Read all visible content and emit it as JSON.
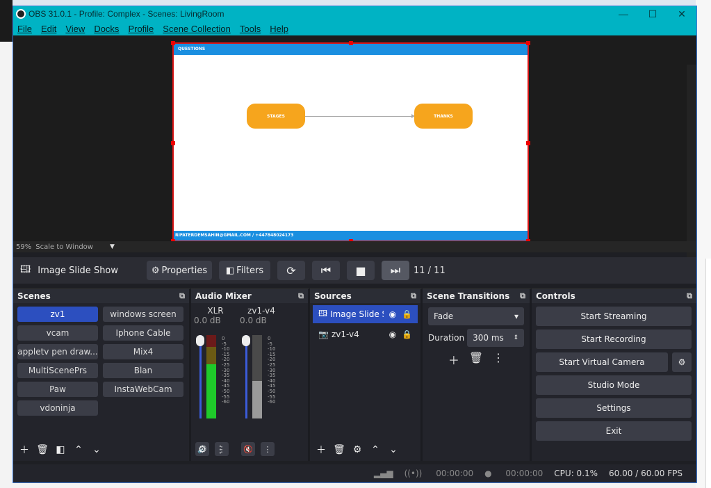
{
  "window": {
    "title": "OBS 31.0.1 - Profile: Complex - Scenes: LivingRoom"
  },
  "menu": [
    "File",
    "Edit",
    "View",
    "Docks",
    "Profile",
    "Scene Collection",
    "Tools",
    "Help"
  ],
  "preview": {
    "slide_header": "QUESTIONS",
    "slide_footer": "RIFATERDEMSAHIN@GMAIL.COM / +447848024173",
    "box_left": "STAGES",
    "box_right": "THANKS",
    "zoom": "59%",
    "scale_mode": "Scale to Window"
  },
  "toolbar": {
    "source_name": "Image Slide Show",
    "properties": "Properties",
    "filters": "Filters",
    "counter": "11 / 11"
  },
  "scenes": {
    "title": "Scenes",
    "items": [
      "zv1",
      "windows screen",
      "vcam",
      "Iphone Cable",
      "appletv pen draw...",
      "Mix4",
      "MultiScenePrs",
      "Blan",
      "Paw",
      "InstaWebCam",
      "vdoninja"
    ]
  },
  "mixer": {
    "title": "Audio Mixer",
    "channels": [
      {
        "name": "XLR",
        "db": "0.0 dB"
      },
      {
        "name": "zv1-v4",
        "db": "0.0 dB"
      }
    ],
    "scale": [
      "0",
      "-5",
      "-10",
      "-15",
      "-20",
      "-25",
      "-30",
      "-35",
      "-40",
      "-45",
      "-50",
      "-55",
      "-60"
    ]
  },
  "sources": {
    "title": "Sources",
    "items": [
      "Image Slide Show",
      "zv1-v4"
    ]
  },
  "transitions": {
    "title": "Scene Transitions",
    "type": "Fade",
    "duration_label": "Duration",
    "duration": "300 ms"
  },
  "controls": {
    "title": "Controls",
    "start_streaming": "Start Streaming",
    "start_recording": "Start Recording",
    "start_virtual_camera": "Start Virtual Camera",
    "studio_mode": "Studio Mode",
    "settings": "Settings",
    "exit": "Exit"
  },
  "status": {
    "stream_time": "00:00:00",
    "rec_time": "00:00:00",
    "cpu": "CPU: 0.1%",
    "fps": "60.00 / 60.00 FPS"
  },
  "colors": {
    "accent": "#00b3c4",
    "selection": "#2c4fbf"
  }
}
